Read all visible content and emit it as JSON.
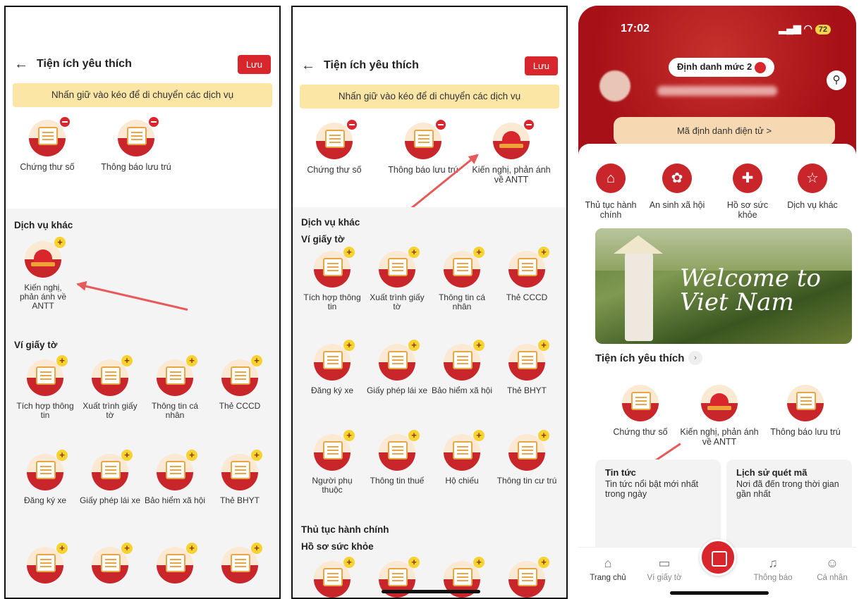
{
  "screen1": {
    "title": "Tiện ích yêu thích",
    "save": "Lưu",
    "hint": "Nhấn giữ vào kéo để di chuyển các dịch vụ",
    "favorites": [
      "Chứng thư số",
      "Thông báo lưu trú"
    ],
    "other_services_title": "Dịch vụ khác",
    "other_service": "Kiến nghị,\nphản ánh về\nANTT",
    "wallet_title": "Ví giấy tờ",
    "wallet_row1": [
      "Tích hợp thông tin",
      "Xuất trình giấy tờ",
      "Thông tin cá nhân",
      "Thẻ CCCD"
    ],
    "wallet_row2": [
      "Đăng ký xe",
      "Giấy phép lái xe",
      "Bảo hiểm xã hội",
      "Thẻ BHYT"
    ]
  },
  "screen2": {
    "title": "Tiện ích yêu thích",
    "save": "Lưu",
    "hint": "Nhấn giữ vào kéo để di chuyển các dịch vụ",
    "favorites": [
      "Chứng thư số",
      "Thông báo lưu trú",
      "Kiến nghị, phản ánh về ANTT"
    ],
    "other_services_title": "Dịch vụ khác",
    "wallet_title": "Ví giấy tờ",
    "wallet_row1": [
      "Tích hợp thông tin",
      "Xuất trình giấy tờ",
      "Thông tin cá nhân",
      "Thẻ CCCD"
    ],
    "wallet_row2": [
      "Đăng ký xe",
      "Giấy phép lái xe",
      "Bảo hiểm xã hội",
      "Thẻ BHYT"
    ],
    "wallet_row3": [
      "Người phụ thuộc",
      "Thông tin thuế",
      "Hộ chiếu",
      "Thông tin cư trú"
    ],
    "admin_title": "Thủ tục hành chính",
    "health_title": "Hồ sơ sức khỏe"
  },
  "screen3": {
    "time": "17:02",
    "status": "72",
    "level_badge": "Định danh mức 2",
    "id_button": "Mã định danh điện tử >",
    "categories": [
      "Thủ tục hành chính",
      "An sinh xã hội",
      "Hồ sơ sức khỏe",
      "Dịch vụ khác"
    ],
    "banner_text": "Welcome to Viet Nam",
    "favorites_title": "Tiện ích yêu thích",
    "favorites": [
      "Chứng thư số",
      "Kiến nghị, phản ánh về ANTT",
      "Thông báo lưu trú"
    ],
    "news_title": "Tin tức",
    "news_desc": "Tin tức nổi bật mới nhất trong ngày",
    "history_title": "Lịch sử quét mã",
    "history_desc": "Nơi đã đến trong thời gian gần nhất",
    "nav": [
      "Trang chủ",
      "Ví giấy tờ",
      "Thông báo",
      "Cá nhân"
    ]
  }
}
